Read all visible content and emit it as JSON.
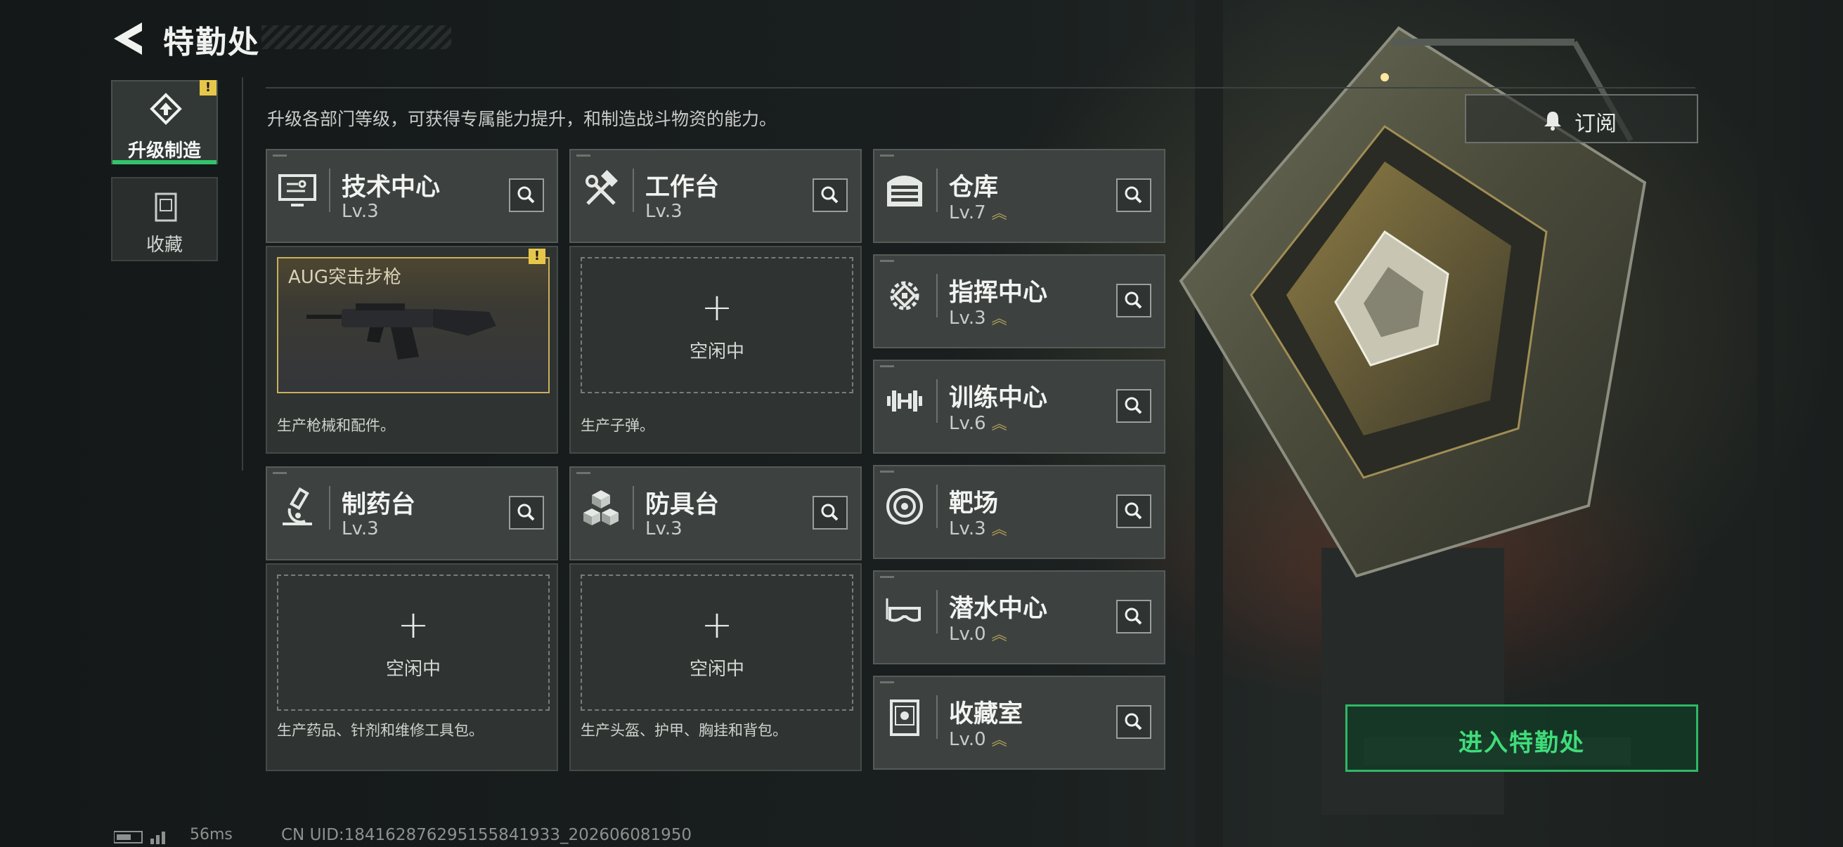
{
  "header": {
    "title": "特勤处"
  },
  "tabs": [
    {
      "label": "升级制造",
      "active": true,
      "has_alert": true,
      "alert_glyph": "!"
    },
    {
      "label": "收藏",
      "active": false
    }
  ],
  "description": "升级各部门等级，可获得专属能力提升，和制造战斗物资的能力。",
  "subscribe_label": "订阅",
  "enter_label": "进入特勤处",
  "departments_main": [
    {
      "name": "技术中心",
      "level": "Lv.3",
      "icon": "monitor-icon",
      "slot": {
        "state": "filled",
        "item_name": "AUG突击步枪",
        "has_alert": true,
        "alert_glyph": "!"
      },
      "desc": "生产枪械和配件。"
    },
    {
      "name": "工作台",
      "level": "Lv.3",
      "icon": "hammer-wrench-icon",
      "slot": {
        "state": "idle",
        "plus": "+",
        "idle_text": "空闲中"
      },
      "desc": "生产子弹。"
    },
    {
      "name": "制药台",
      "level": "Lv.3",
      "icon": "microscope-icon",
      "slot": {
        "state": "idle",
        "plus": "+",
        "idle_text": "空闲中"
      },
      "desc": "生产药品、针剂和维修工具包。"
    },
    {
      "name": "防具台",
      "level": "Lv.3",
      "icon": "cubes-icon",
      "slot": {
        "state": "idle",
        "plus": "+",
        "idle_text": "空闲中"
      },
      "desc": "生产头盔、护甲、胸挂和背包。"
    }
  ],
  "departments_side": [
    {
      "name": "仓库",
      "level": "Lv.7",
      "upgradable": true,
      "icon": "garage-icon"
    },
    {
      "name": "指挥中心",
      "level": "Lv.3",
      "upgradable": true,
      "icon": "chip-icon"
    },
    {
      "name": "训练中心",
      "level": "Lv.6",
      "upgradable": true,
      "icon": "dumbbell-icon"
    },
    {
      "name": "靶场",
      "level": "Lv.3",
      "upgradable": true,
      "icon": "target-icon"
    },
    {
      "name": "潜水中心",
      "level": "Lv.0",
      "upgradable": true,
      "icon": "diving-mask-icon"
    },
    {
      "name": "收藏室",
      "level": "Lv.0",
      "upgradable": true,
      "icon": "trophy-case-icon"
    }
  ],
  "upgrade_chevron": "︽",
  "status_bar": {
    "ping": "56ms",
    "uid": "CN UID:18416287629515584193​3_202606081950"
  }
}
